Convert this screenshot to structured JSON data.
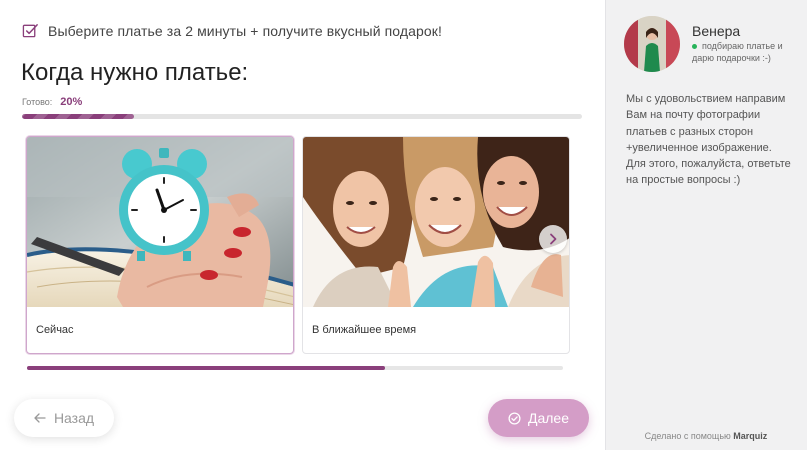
{
  "promo": {
    "text": "Выберите платье за 2 минуты + получите вкусный подарок!",
    "icon": "checklist-icon"
  },
  "question": {
    "title": "Когда нужно платье:"
  },
  "progress": {
    "label": "Готово:",
    "value_text": "20%",
    "value": 0.2
  },
  "options": [
    {
      "label": "Сейчас",
      "selected": true,
      "image": "alarm-clock-photo"
    },
    {
      "label": "В ближайшее время",
      "selected": false,
      "image": "smiling-women-photo"
    }
  ],
  "carousel": {
    "next_icon": "chevron-right-icon",
    "scroll_value": 0.667
  },
  "nav": {
    "back_label": "Назад",
    "next_label": "Далее"
  },
  "manager": {
    "name": "Венера",
    "status": "подбираю платье и дарю подарочки :-)",
    "message": "Мы с удовольствием направим Вам на почту фотографии платьев с разных сторон +увеличенное изображение.\nДля этого, пожалуйста, ответьте на простые вопросы :)"
  },
  "footer": {
    "credit_prefix": "Сделано с помощью",
    "credit_brand": "Marquiz"
  },
  "colors": {
    "accent": "#8a3f7b",
    "button": "#d49dc7",
    "sidebar_bg": "#f1f1f2",
    "online": "#27b35a"
  }
}
